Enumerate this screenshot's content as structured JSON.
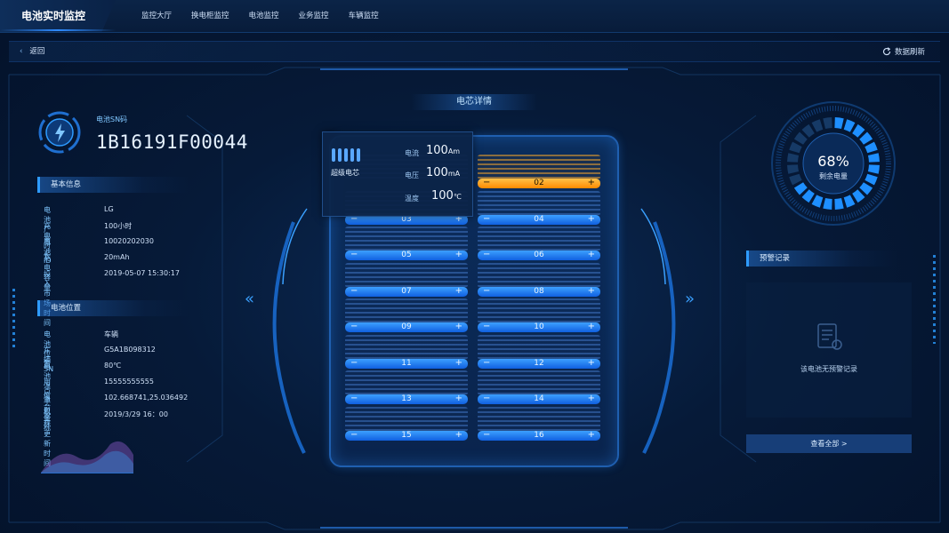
{
  "header": {
    "app_title": "电池实时监控",
    "nav": [
      "监控大厅",
      "换电柜监控",
      "电池监控",
      "业务监控",
      "车辆监控"
    ]
  },
  "subbar": {
    "back_label": "返回",
    "refresh_label": "数据刷新"
  },
  "battery": {
    "sn_label": "电池SN码",
    "sn_value": "1B16191F00044"
  },
  "basic_info": {
    "title": "基本信息",
    "rows": [
      {
        "k": "电池厂商",
        "v": "LG"
      },
      {
        "k": "充电时长",
        "v": "100小时"
      },
      {
        "k": "电池ID",
        "v": "10020202030"
      },
      {
        "k": "充电容量",
        "v": "20mAh"
      },
      {
        "k": "投入市场时间",
        "v": "2019-05-07 15:30:17"
      }
    ]
  },
  "location_info": {
    "title": "电池位置",
    "rows": [
      {
        "k": "电池位置",
        "v": "车辆"
      },
      {
        "k": "车辆SN",
        "v": "G5A1B098312"
      },
      {
        "k": "电池温度",
        "v": "80℃"
      },
      {
        "k": "用户手机号",
        "v": "15555555555"
      },
      {
        "k": "当前坐标",
        "v": "102.668741,25.036492"
      },
      {
        "k": "坐标更新时间",
        "v": "2019/3/29 16：00"
      }
    ]
  },
  "cells_panel": {
    "title": "电芯详情",
    "cells": [
      "02",
      "03",
      "04",
      "05",
      "06",
      "07",
      "08",
      "09",
      "10",
      "11",
      "12",
      "13",
      "14",
      "15",
      "16"
    ],
    "hot_cell": "02"
  },
  "popup": {
    "name": "超级电芯",
    "current_label": "电流",
    "current_value": "100",
    "current_unit": "Am",
    "voltage_label": "电压",
    "voltage_value": "100",
    "voltage_unit": "mA",
    "temp_label": "温度",
    "temp_value": "100",
    "temp_unit": "℃"
  },
  "charge": {
    "percent_text": "68%",
    "percent": 68,
    "label": "剩余电量"
  },
  "warnings": {
    "title": "预警记录",
    "empty_text": "该电池无预警记录",
    "view_all": "查看全部 >"
  },
  "colors": {
    "accent": "#2e9bff",
    "hot": "#ff9a1a",
    "bg": "#061a38"
  }
}
